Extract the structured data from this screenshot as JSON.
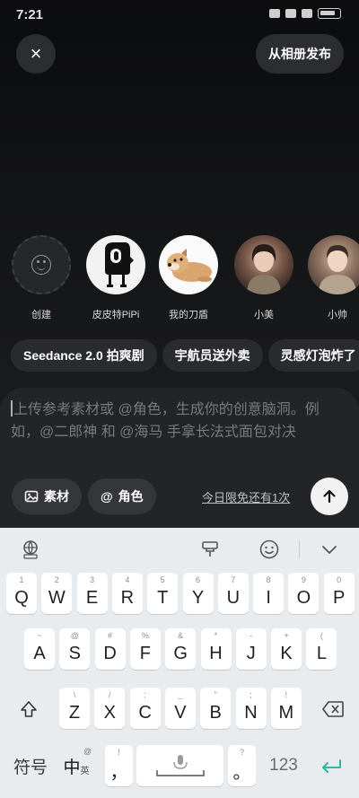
{
  "status": {
    "time": "7:21"
  },
  "header": {
    "close_icon": "×",
    "album_button": "从相册发布"
  },
  "characters": [
    {
      "name": "创建",
      "icon": "smile-plus-icon"
    },
    {
      "name": "皮皮特PiPi",
      "icon": "pipi-mascot"
    },
    {
      "name": "我的刀盾",
      "icon": "dog-avatar"
    },
    {
      "name": "小美",
      "icon": "girl-avatar"
    },
    {
      "name": "小帅",
      "icon": "boy-avatar"
    }
  ],
  "tags": [
    "Seedance 2.0 拍爽剧",
    "宇航员送外卖",
    "灵感灯泡炸了"
  ],
  "composer": {
    "placeholder": "上传参考素材或 @角色，生成你的创意脑洞。例如，@二郎神 和 @海马 手拿长法式面包对决",
    "material_label": "素材",
    "role_label": "角色",
    "role_prefix": "@",
    "free_text": "今日限免还有1次"
  },
  "keyboard": {
    "row1": [
      {
        "sub": "1",
        "key": "Q"
      },
      {
        "sub": "2",
        "key": "W"
      },
      {
        "sub": "3",
        "key": "E"
      },
      {
        "sub": "4",
        "key": "R"
      },
      {
        "sub": "5",
        "key": "T"
      },
      {
        "sub": "6",
        "key": "Y"
      },
      {
        "sub": "7",
        "key": "U"
      },
      {
        "sub": "8",
        "key": "I"
      },
      {
        "sub": "9",
        "key": "O"
      },
      {
        "sub": "0",
        "key": "P"
      }
    ],
    "row2": [
      {
        "sub": "~",
        "key": "A"
      },
      {
        "sub": "@",
        "key": "S"
      },
      {
        "sub": "#",
        "key": "D"
      },
      {
        "sub": "%",
        "key": "F"
      },
      {
        "sub": "&",
        "key": "G"
      },
      {
        "sub": "*",
        "key": "H"
      },
      {
        "sub": "-",
        "key": "J"
      },
      {
        "sub": "+",
        "key": "K"
      },
      {
        "sub": "(",
        "key": "L"
      }
    ],
    "row3": [
      {
        "sub": "\\",
        "key": "Z"
      },
      {
        "sub": "/",
        "key": "X"
      },
      {
        "sub": ":",
        "key": "C"
      },
      {
        "sub": "_",
        "key": "V"
      },
      {
        "sub": "\"",
        "key": "B"
      },
      {
        "sub": ";",
        "key": "N"
      },
      {
        "sub": "!",
        "key": "M"
      }
    ],
    "symbols_label": "符号",
    "lang_label": "中",
    "lang_sub": "英",
    "lang_at": "@",
    "comma": "，",
    "comma_sub": "!",
    "period": "。",
    "period_sub": "?",
    "num_label": "123"
  }
}
